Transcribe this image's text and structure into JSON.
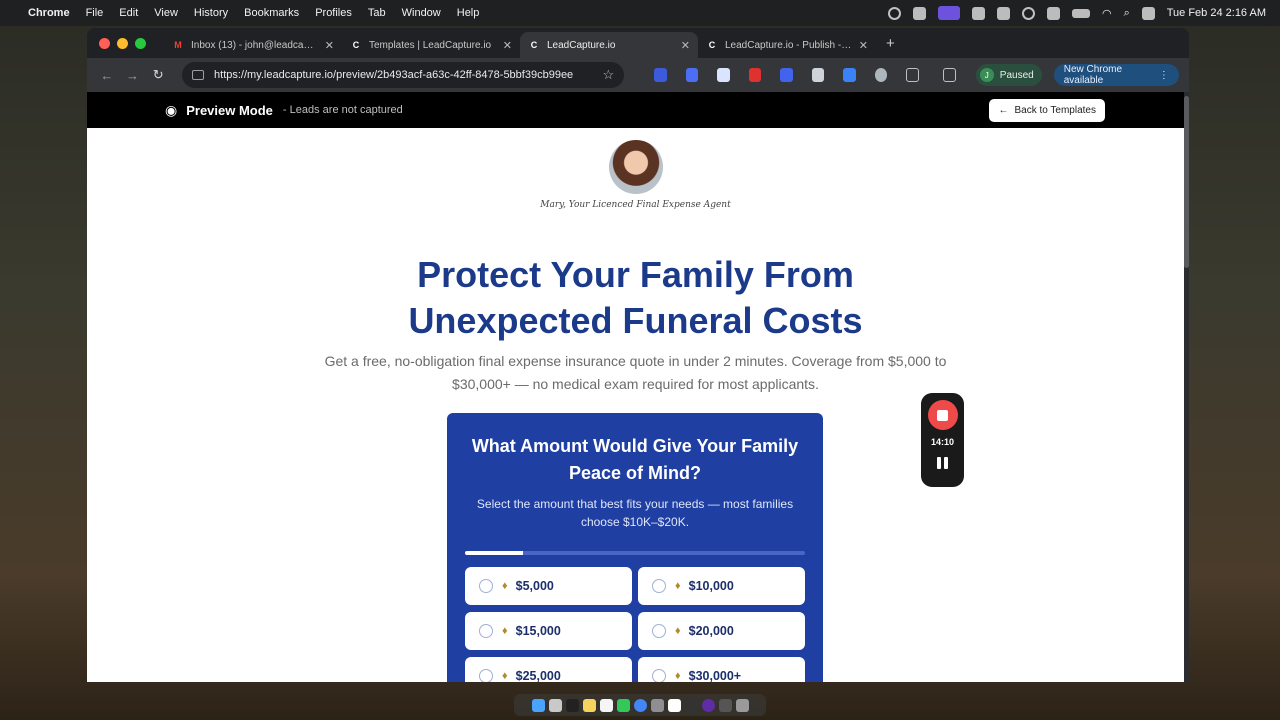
{
  "menubar": {
    "app": "Chrome",
    "items": [
      "File",
      "Edit",
      "View",
      "History",
      "Bookmarks",
      "Profiles",
      "Tab",
      "Window",
      "Help"
    ],
    "clock": "Tue Feb 24  2:16 AM"
  },
  "tabs": [
    {
      "title": "Inbox (13) - john@leadcapture.io",
      "favicon_color": "#ea4335",
      "active": false
    },
    {
      "title": "Templates | LeadCapture.io",
      "favicon_color": "#ffffff",
      "active": false
    },
    {
      "title": "LeadCapture.io",
      "favicon_color": "#ffffff",
      "active": true
    },
    {
      "title": "LeadCapture.io - Publish - 21",
      "favicon_color": "#ffffff",
      "active": false
    }
  ],
  "toolbar": {
    "url": "https://my.leadcapture.io/preview/2b493acf-a63c-42ff-8478-5bbf39cb99ee",
    "profile_initial": "J",
    "profile_status": "Paused",
    "update_label": "New Chrome available"
  },
  "preview_bar": {
    "mode_label": "Preview Mode",
    "note": "- Leads are not captured",
    "back_label": "Back to Templates"
  },
  "hero": {
    "agent_caption": "Mary, Your Licenced Final Expense Agent",
    "headline_line1": "Protect Your Family From",
    "headline_line2": "Unexpected Funeral Costs",
    "subhead": "Get a free, no-obligation final expense insurance quote in under 2 minutes. Coverage from $5,000 to $30,000+ — no medical exam required for most applicants."
  },
  "quiz": {
    "question": "What Amount Would Give Your Family Peace of Mind?",
    "hint": "Select the amount that best fits your needs — most families choose $10K–$20K.",
    "progress": 0.17,
    "options": [
      "$5,000",
      "$10,000",
      "$15,000",
      "$20,000",
      "$25,000",
      "$30,000+"
    ]
  },
  "recorder": {
    "time": "14:10"
  },
  "colors": {
    "brand_blue": "#1f3fa3",
    "headline_blue": "#1c3a8a",
    "record_red": "#ef4a4a"
  }
}
